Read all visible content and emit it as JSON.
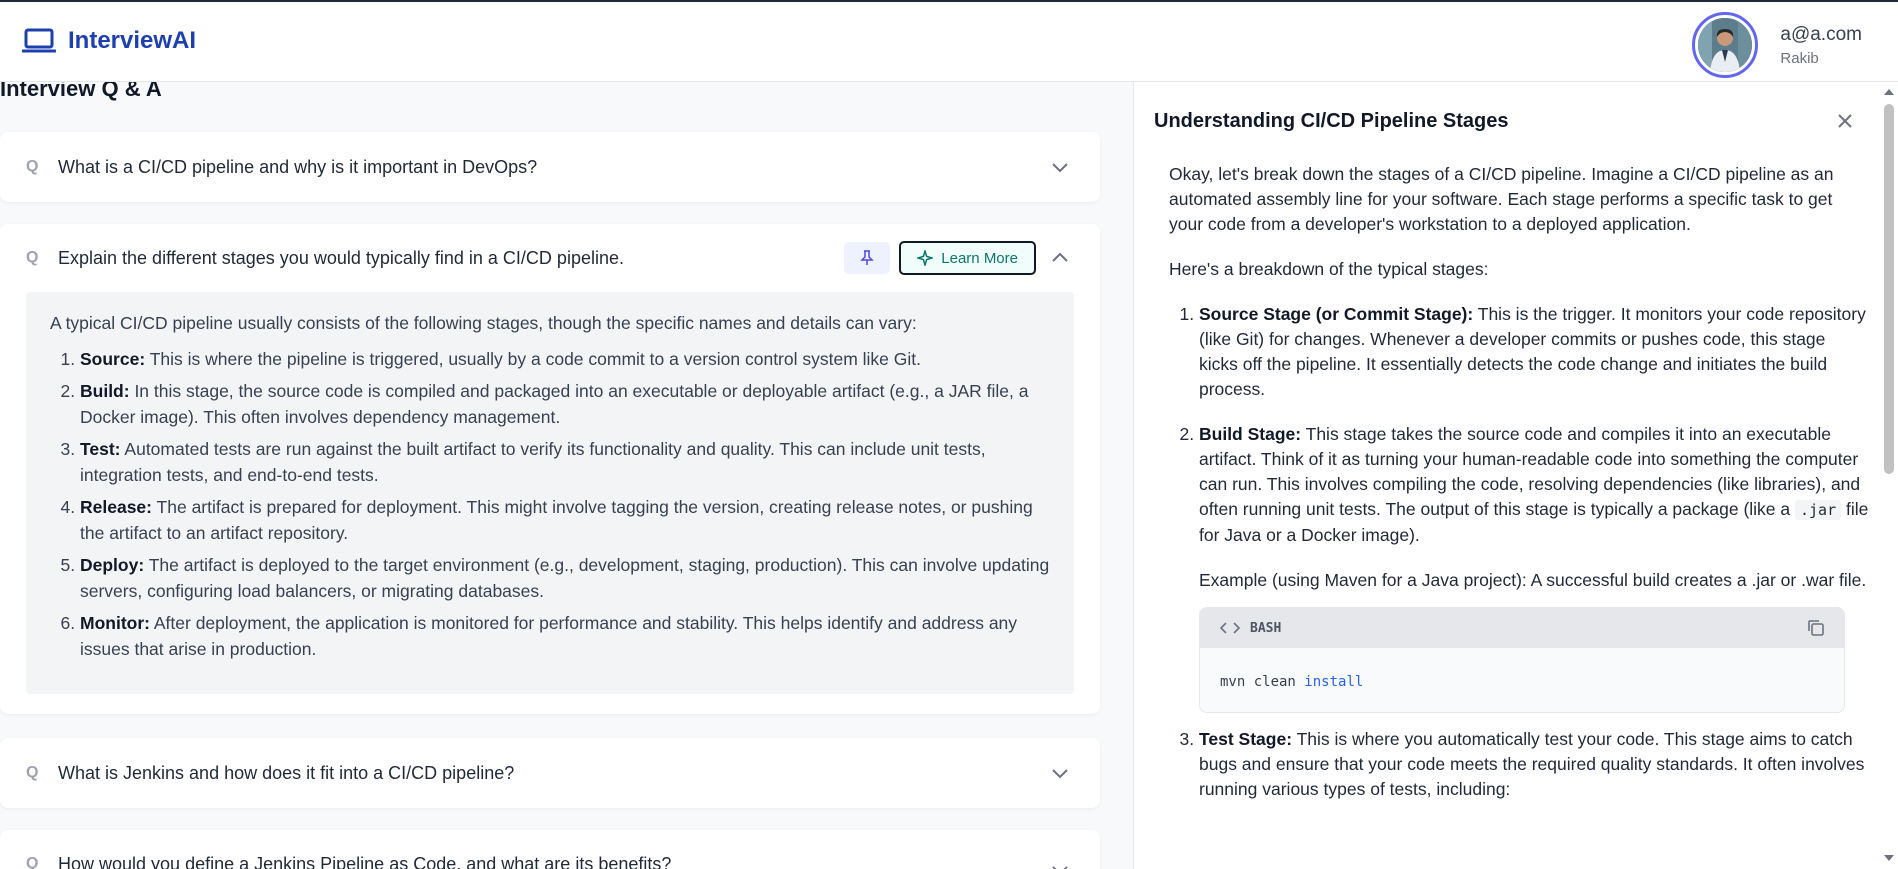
{
  "header": {
    "brand": "InterviewAI",
    "user_email": "a@a.com",
    "user_name": "Rakib"
  },
  "page_title": "Interview Q & A",
  "questions": [
    {
      "q": "Q",
      "text": "What is a CI/CD pipeline and why is it important in DevOps?"
    },
    {
      "q": "Q",
      "text": "Explain the different stages you would typically find in a CI/CD pipeline.",
      "learn_more": "Learn More"
    },
    {
      "q": "Q",
      "text": "What is Jenkins and how does it fit into a CI/CD pipeline?"
    },
    {
      "q": "Q",
      "text": "How would you define a Jenkins Pipeline as Code, and what are its benefits?"
    }
  ],
  "answer": {
    "intro": "A typical CI/CD pipeline usually consists of the following stages, though the specific names and details can vary:",
    "items": [
      {
        "term": "Source:",
        "desc": " This is where the pipeline is triggered, usually by a code commit to a version control system like Git."
      },
      {
        "term": "Build:",
        "desc": " In this stage, the source code is compiled and packaged into an executable or deployable artifact (e.g., a JAR file, a Docker image). This often involves dependency management."
      },
      {
        "term": "Test:",
        "desc": " Automated tests are run against the built artifact to verify its functionality and quality. This can include unit tests, integration tests, and end-to-end tests."
      },
      {
        "term": "Release:",
        "desc": " The artifact is prepared for deployment. This might involve tagging the version, creating release notes, or pushing the artifact to an artifact repository."
      },
      {
        "term": "Deploy:",
        "desc": " The artifact is deployed to the target environment (e.g., development, staging, production). This can involve updating servers, configuring load balancers, or migrating databases."
      },
      {
        "term": "Monitor:",
        "desc": " After deployment, the application is monitored for performance and stability. This helps identify and address any issues that arise in production."
      }
    ]
  },
  "panel": {
    "title": "Understanding CI/CD Pipeline Stages",
    "p1": "Okay, let's break down the stages of a CI/CD pipeline. Imagine a CI/CD pipeline as an automated assembly line for your software. Each stage performs a specific task to get your code from a developer's workstation to a deployed application.",
    "p2": "Here's a breakdown of the typical stages:",
    "s1_term": "Source Stage (or Commit Stage):",
    "s1_desc": " This is the trigger. It monitors your code repository (like Git) for changes. Whenever a developer commits or pushes code, this stage kicks off the pipeline. It essentially detects the code change and initiates the build process.",
    "s2_term": "Build Stage:",
    "s2_desc_a": " This stage takes the source code and compiles it into an executable artifact. Think of it as turning your human-readable code into something the computer can run. This involves compiling the code, resolving dependencies (like libraries), and often running unit tests. The output of this stage is typically a package (like a ",
    "s2_code": ".jar",
    "s2_desc_b": " file for Java or a Docker image).",
    "s2_example": "Example (using Maven for a Java project): A successful build creates a .jar or .war file.",
    "code_lang": "BASH",
    "code_plain": "mvn clean ",
    "code_kw": "install",
    "s3_term": "Test Stage:",
    "s3_desc": " This is where you automatically test your code. This stage aims to catch bugs and ensure that your code meets the required quality standards. It often involves running various types of tests, including:"
  }
}
